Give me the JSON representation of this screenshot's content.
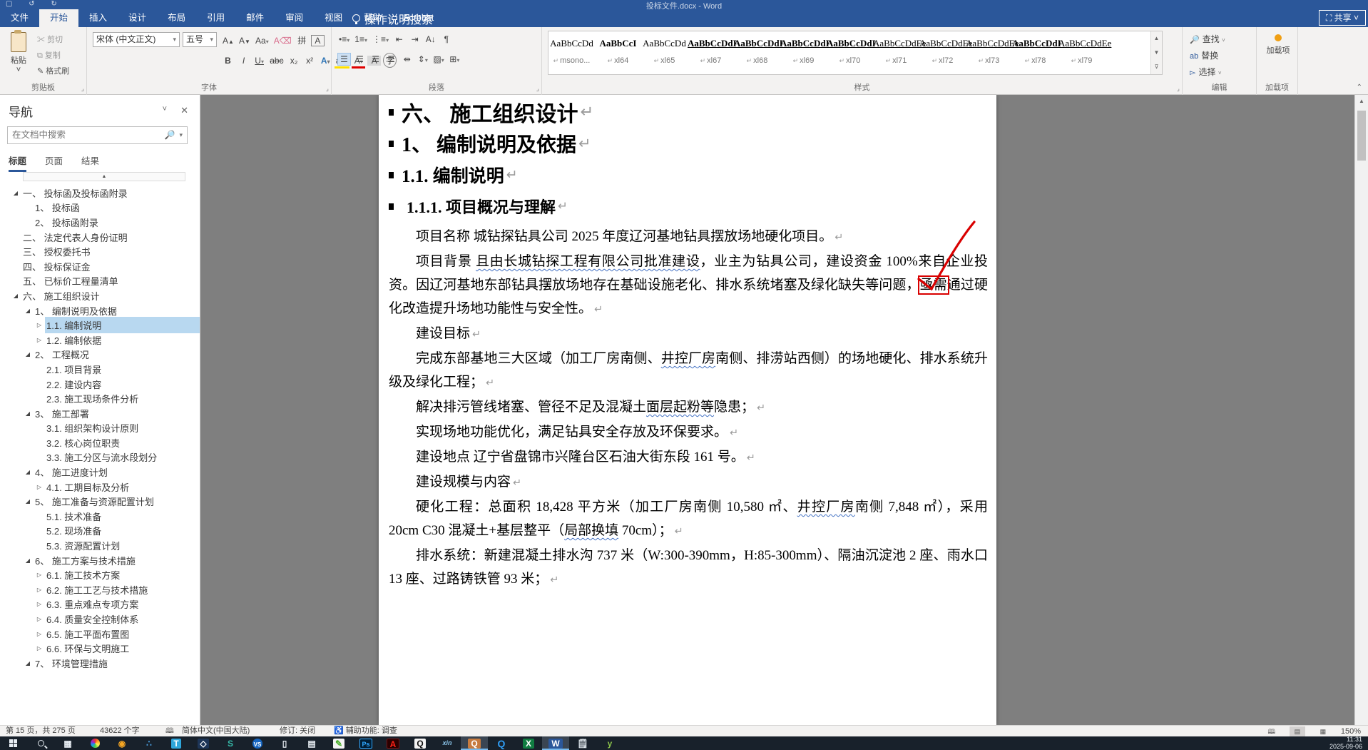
{
  "window": {
    "title": "投标文件.docx - Word",
    "share_label": "共享"
  },
  "ribbon": {
    "tabs": [
      {
        "label": "文件",
        "cls": ""
      },
      {
        "label": "开始",
        "cls": "active"
      },
      {
        "label": "插入",
        "cls": ""
      },
      {
        "label": "设计",
        "cls": ""
      },
      {
        "label": "布局",
        "cls": ""
      },
      {
        "label": "引用",
        "cls": ""
      },
      {
        "label": "邮件",
        "cls": ""
      },
      {
        "label": "审阅",
        "cls": ""
      },
      {
        "label": "视图",
        "cls": ""
      },
      {
        "label": "帮助",
        "cls": ""
      },
      {
        "label": "Acrobat",
        "cls": ""
      }
    ],
    "tell_me": "操作说明搜索",
    "clipboard": {
      "label": "剪贴板",
      "paste": "粘贴",
      "cut": "剪切",
      "copy": "复制",
      "painter": "格式刷"
    },
    "font": {
      "label": "字体",
      "name": "宋体 (中文正文)",
      "size": "五号"
    },
    "paragraph": {
      "label": "段落"
    },
    "styles": {
      "label": "样式",
      "items": [
        {
          "sample": "AaBbCcDd",
          "name": "msono...",
          "cls": ""
        },
        {
          "sample": "AaBbCcI",
          "name": "xl64",
          "cls": "bold"
        },
        {
          "sample": "AaBbCcDd",
          "name": "xl65",
          "cls": ""
        },
        {
          "sample": "AaBbCcDdI",
          "name": "xl67",
          "cls": "bold underl"
        },
        {
          "sample": "AaBbCcDdI",
          "name": "xl68",
          "cls": "bold underl"
        },
        {
          "sample": "AaBbCcDdI",
          "name": "xl69",
          "cls": "bold underl"
        },
        {
          "sample": "AaBbCcDdI",
          "name": "xl70",
          "cls": "bold underl"
        },
        {
          "sample": "AaBbCcDdEe",
          "name": "xl71",
          "cls": "underl"
        },
        {
          "sample": "AaBbCcDdEe",
          "name": "xl72",
          "cls": "underl"
        },
        {
          "sample": "AaBbCcDdEe",
          "name": "xl73",
          "cls": "underl"
        },
        {
          "sample": "AaBbCcDdI",
          "name": "xl78",
          "cls": "bold underl"
        },
        {
          "sample": "AaBbCcDdEe",
          "name": "xl79",
          "cls": "underl"
        }
      ]
    },
    "editing": {
      "label": "编辑",
      "find": "查找",
      "replace": "替换",
      "select": "选择"
    },
    "addins": {
      "label": "加载项",
      "button": "加载项"
    }
  },
  "navigation": {
    "title": "导航",
    "search_placeholder": "在文档中搜索",
    "tabs": [
      {
        "label": "标题",
        "cls": "active"
      },
      {
        "label": "页面",
        "cls": ""
      },
      {
        "label": "结果",
        "cls": ""
      }
    ],
    "tree": [
      {
        "label": "一、 投标函及投标函附录",
        "cls": "l1 exp"
      },
      {
        "label": "1、 投标函",
        "cls": "l2"
      },
      {
        "label": "2、 投标函附录",
        "cls": "l2"
      },
      {
        "label": "二、 法定代表人身份证明",
        "cls": "l1"
      },
      {
        "label": "三、 授权委托书",
        "cls": "l1"
      },
      {
        "label": "四、 投标保证金",
        "cls": "l1"
      },
      {
        "label": "五、 已标价工程量清单",
        "cls": "l1"
      },
      {
        "label": "六、 施工组织设计",
        "cls": "l1 exp"
      },
      {
        "label": "1、 编制说明及依据",
        "cls": "l2 exp"
      },
      {
        "label": "1.1. 编制说明",
        "cls": "l3 col sel"
      },
      {
        "label": "1.2. 编制依据",
        "cls": "l3 col"
      },
      {
        "label": "2、 工程概况",
        "cls": "l2 exp"
      },
      {
        "label": "2.1. 项目背景",
        "cls": "l3"
      },
      {
        "label": "2.2. 建设内容",
        "cls": "l3"
      },
      {
        "label": "2.3. 施工现场条件分析",
        "cls": "l3"
      },
      {
        "label": "3、 施工部署",
        "cls": "l2 exp"
      },
      {
        "label": "3.1. 组织架构设计原则",
        "cls": "l3"
      },
      {
        "label": "3.2. 核心岗位职责",
        "cls": "l3"
      },
      {
        "label": "3.3. 施工分区与流水段划分",
        "cls": "l3"
      },
      {
        "label": "4、 施工进度计划",
        "cls": "l2 exp"
      },
      {
        "label": "4.1. 工期目标及分析",
        "cls": "l3 col"
      },
      {
        "label": "5、 施工准备与资源配置计划",
        "cls": "l2 exp"
      },
      {
        "label": "5.1. 技术准备",
        "cls": "l3"
      },
      {
        "label": "5.2. 现场准备",
        "cls": "l3"
      },
      {
        "label": "5.3. 资源配置计划",
        "cls": "l3"
      },
      {
        "label": "6、 施工方案与技术措施",
        "cls": "l2 exp"
      },
      {
        "label": "6.1. 施工技术方案",
        "cls": "l3 col"
      },
      {
        "label": "6.2. 施工工艺与技术措施",
        "cls": "l3 col"
      },
      {
        "label": "6.3. 重点难点专项方案",
        "cls": "l3 col"
      },
      {
        "label": "6.4. 质量安全控制体系",
        "cls": "l3 col"
      },
      {
        "label": "6.5. 施工平面布置图",
        "cls": "l3 col"
      },
      {
        "label": "6.6. 环保与文明施工",
        "cls": "l3 col"
      },
      {
        "label": "7、 环境管理措施",
        "cls": "l2 exp"
      }
    ]
  },
  "document": {
    "headings": [
      {
        "text": "六、 施工组织设计",
        "cls": "h1"
      },
      {
        "text": "1、 编制说明及依据",
        "cls": "h2"
      },
      {
        "text": "1.1. 编制说明",
        "cls": "h3"
      },
      {
        "text": "1.1.1. 项目概况与理解",
        "cls": "h4"
      }
    ],
    "paragraphs": [
      {
        "cls": "ind",
        "segments": [
          {
            "t": "项目名称 城钻探钻具公司 2025 年度辽河基地钻具摆放场地硬化项目。"
          }
        ]
      },
      {
        "cls": "ind",
        "segments": [
          {
            "t": "项目背景 "
          },
          {
            "t": "且由长城钻探工程有限公司批准建设",
            "cls": "wavy"
          },
          {
            "t": "，业主为钻具公司，建设资金 100%来自企业投资。因辽河基地东部钻具摆放场地存在基础设施老化、排水系统堵塞及绿化缺失等问题，"
          },
          {
            "t": "亟需",
            "cls": "redbox"
          },
          {
            "t": "通过硬化改造提升场地功能性与安全性。"
          }
        ]
      },
      {
        "cls": "ind",
        "segments": [
          {
            "t": "建设目标"
          }
        ]
      },
      {
        "cls": "ind",
        "segments": [
          {
            "t": "完成东部基地三大区域（加工厂房南侧、"
          },
          {
            "t": "井控厂房",
            "cls": "wavy"
          },
          {
            "t": "南侧、排涝站西侧）的场地硬化、排水系统升级及绿化工程；"
          }
        ]
      },
      {
        "cls": "ind",
        "segments": [
          {
            "t": "解决排污管线堵塞、管径不足及混凝土"
          },
          {
            "t": "面层起粉等",
            "cls": "wavy"
          },
          {
            "t": "隐患；"
          }
        ]
      },
      {
        "cls": "ind",
        "segments": [
          {
            "t": "实现场地功能优化，满足钻具安全存放及环保要求。"
          }
        ]
      },
      {
        "cls": "ind",
        "segments": [
          {
            "t": "建设地点 辽宁省盘锦市兴隆台区石油大街东段 161 号。"
          }
        ]
      },
      {
        "cls": "ind",
        "segments": [
          {
            "t": "建设规模与内容"
          }
        ]
      },
      {
        "cls": "ind",
        "segments": [
          {
            "t": "硬化工程：总面积 18,428 平方米（加工厂房南侧 10,580 ㎡、"
          },
          {
            "t": "井控厂房",
            "cls": "wavy"
          },
          {
            "t": "南侧 7,848 ㎡），采用 20cm C30 混凝土+基层整平（"
          },
          {
            "t": "局部换填",
            "cls": "wavy"
          },
          {
            "t": " 70cm）；"
          }
        ]
      },
      {
        "cls": "ind",
        "segments": [
          {
            "t": "排水系统：新建混凝土排水沟 737 米（W:300-390mm，H:85-300mm）、隔油沉淀池 2 座、雨水口 13 座、过路铸铁管 93 米；"
          }
        ]
      }
    ],
    "ink_color": "#d90000"
  },
  "status_bar": {
    "page_info": "第 15 页，共 275 页",
    "word_count": "43622 个字",
    "language": "简体中文(中国大陆)",
    "revisions": "修订: 关闭",
    "accessibility": "辅助功能: 调查",
    "zoom": "150%"
  },
  "taskbar": {
    "time": "11:31",
    "date": "2025-09-06",
    "icons": [
      {
        "name": "start-button",
        "kind": "win",
        "glyph": ""
      },
      {
        "name": "search-button",
        "kind": "search",
        "glyph": ""
      },
      {
        "name": "grid-app-icon",
        "kind": "glyph",
        "glyph": "▦",
        "cls": "c-white"
      },
      {
        "name": "color-wheel-app-icon",
        "kind": "wheel",
        "glyph": ""
      },
      {
        "name": "screenshot-app-icon",
        "kind": "glyph",
        "glyph": "◉",
        "cls": "c-orange"
      },
      {
        "name": "dots-app-icon",
        "kind": "glyph",
        "glyph": "∴",
        "cls": "c-blue"
      },
      {
        "name": "telegram-app-icon",
        "kind": "tile",
        "glyph": "T",
        "cls": "bg-telegram"
      },
      {
        "name": "diamond-app-icon",
        "kind": "tile",
        "glyph": "◇",
        "cls": "bg-navy"
      },
      {
        "name": "swirl-app-icon",
        "kind": "glyph",
        "glyph": "S",
        "cls": "c-teal"
      },
      {
        "name": "vs-app-icon",
        "kind": "tile",
        "glyph": "VS",
        "cls": "bg-blue"
      },
      {
        "name": "cup-app-icon",
        "kind": "glyph",
        "glyph": "▯",
        "cls": "c-white"
      },
      {
        "name": "document-app-icon",
        "kind": "glyph",
        "glyph": "▤",
        "cls": "c-white"
      },
      {
        "name": "pen-app-icon",
        "kind": "tile",
        "glyph": "✎",
        "cls": "bg-white c-green"
      },
      {
        "name": "photoshop-app-icon",
        "kind": "tile",
        "glyph": "Ps",
        "cls": "bg-ps"
      },
      {
        "name": "acrobat-app-icon",
        "kind": "tile",
        "glyph": "A",
        "cls": "bg-acrobat"
      },
      {
        "name": "qq-app-icon",
        "kind": "tile",
        "glyph": "Q",
        "cls": "bg-white c-black"
      },
      {
        "name": "xin-app-icon",
        "kind": "glyph",
        "glyph": "xin",
        "cls": "c-lightblue"
      },
      {
        "name": "chat-app-icon",
        "kind": "tile",
        "glyph": "Q",
        "cls": "bg-orange",
        "active": true
      },
      {
        "name": "qq-browser-app-icon",
        "kind": "glyph",
        "glyph": "Q",
        "cls": "c-qblue"
      },
      {
        "name": "excel-app-icon",
        "kind": "tile",
        "glyph": "X",
        "cls": "bg-excel"
      },
      {
        "name": "word-app-icon",
        "kind": "tile",
        "glyph": "W",
        "cls": "bg-word",
        "active": true
      },
      {
        "name": "notepad-app-icon",
        "kind": "glyph",
        "glyph": "🗒",
        "cls": "c-paper"
      },
      {
        "name": "green-app-icon",
        "kind": "glyph",
        "glyph": "y",
        "cls": "c-greeny"
      }
    ]
  }
}
